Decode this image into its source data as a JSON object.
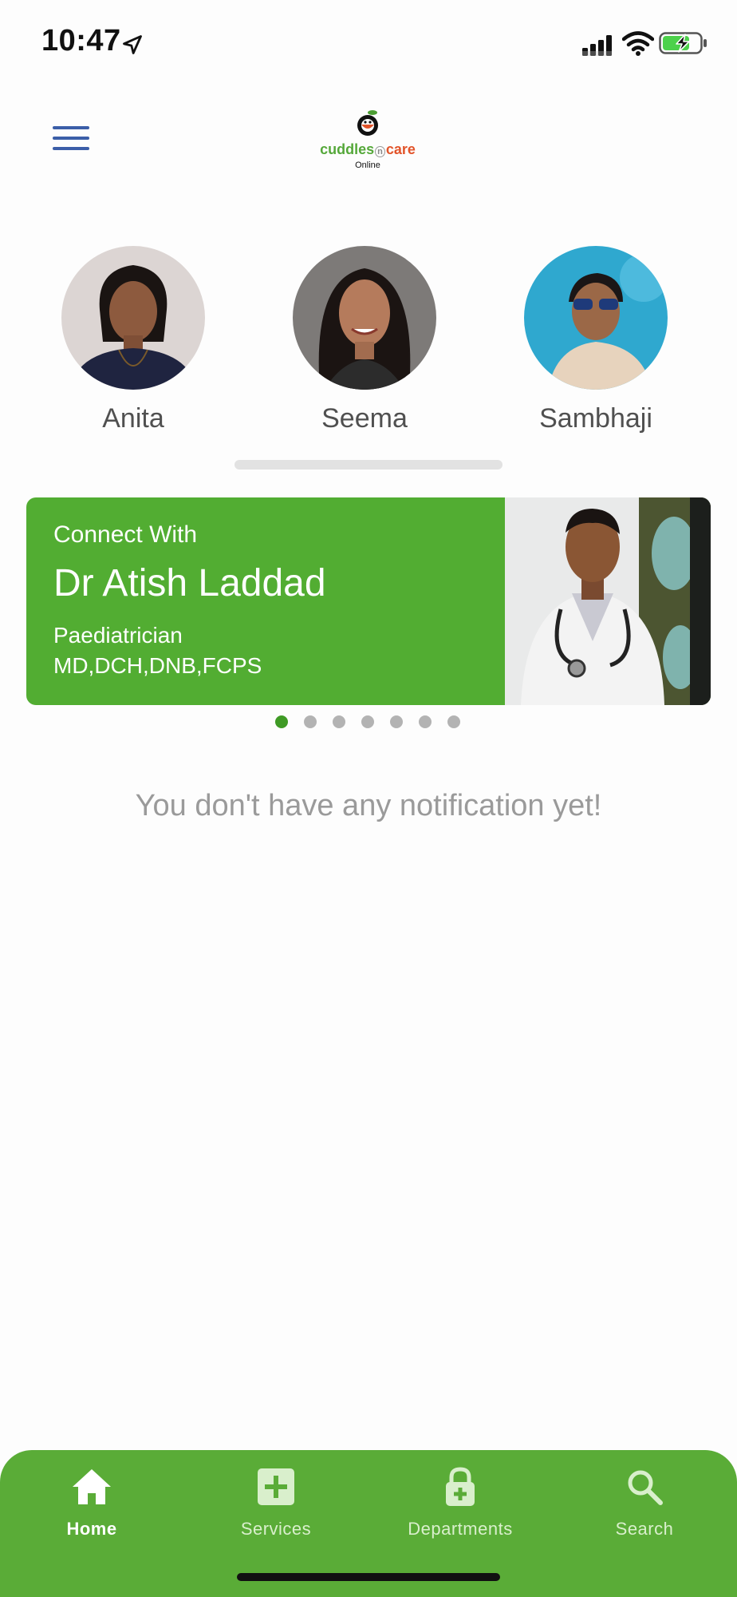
{
  "status_bar": {
    "time": "10:47"
  },
  "header": {
    "logo": {
      "cuddles": "cuddles",
      "n": "n",
      "care": "care",
      "sub": "Online"
    }
  },
  "doctors": [
    {
      "name": "Anita"
    },
    {
      "name": "Seema"
    },
    {
      "name": "Sambhaji"
    }
  ],
  "banner": {
    "connect_label": "Connect With",
    "doctor_name": "Dr Atish Laddad",
    "specialty": "Paediatrician",
    "degrees": "MD,DCH,DNB,FCPS"
  },
  "carousel": {
    "total": 7,
    "active_index": 0
  },
  "notifications": {
    "empty_message": "You don't have any notification yet!"
  },
  "bottom_nav": {
    "items": [
      {
        "label": "Home",
        "icon": "home-icon",
        "active": true
      },
      {
        "label": "Services",
        "icon": "plus-box-icon",
        "active": false
      },
      {
        "label": "Departments",
        "icon": "lock-plus-icon",
        "active": false
      },
      {
        "label": "Search",
        "icon": "search-icon",
        "active": false
      }
    ]
  },
  "colors": {
    "brand_green": "#52ad32",
    "nav_green": "#5aac37",
    "active_dot": "#3f9a25",
    "menu_blue": "#3b5ea8",
    "logo_green": "#55a83a",
    "logo_orange": "#e2542a"
  }
}
